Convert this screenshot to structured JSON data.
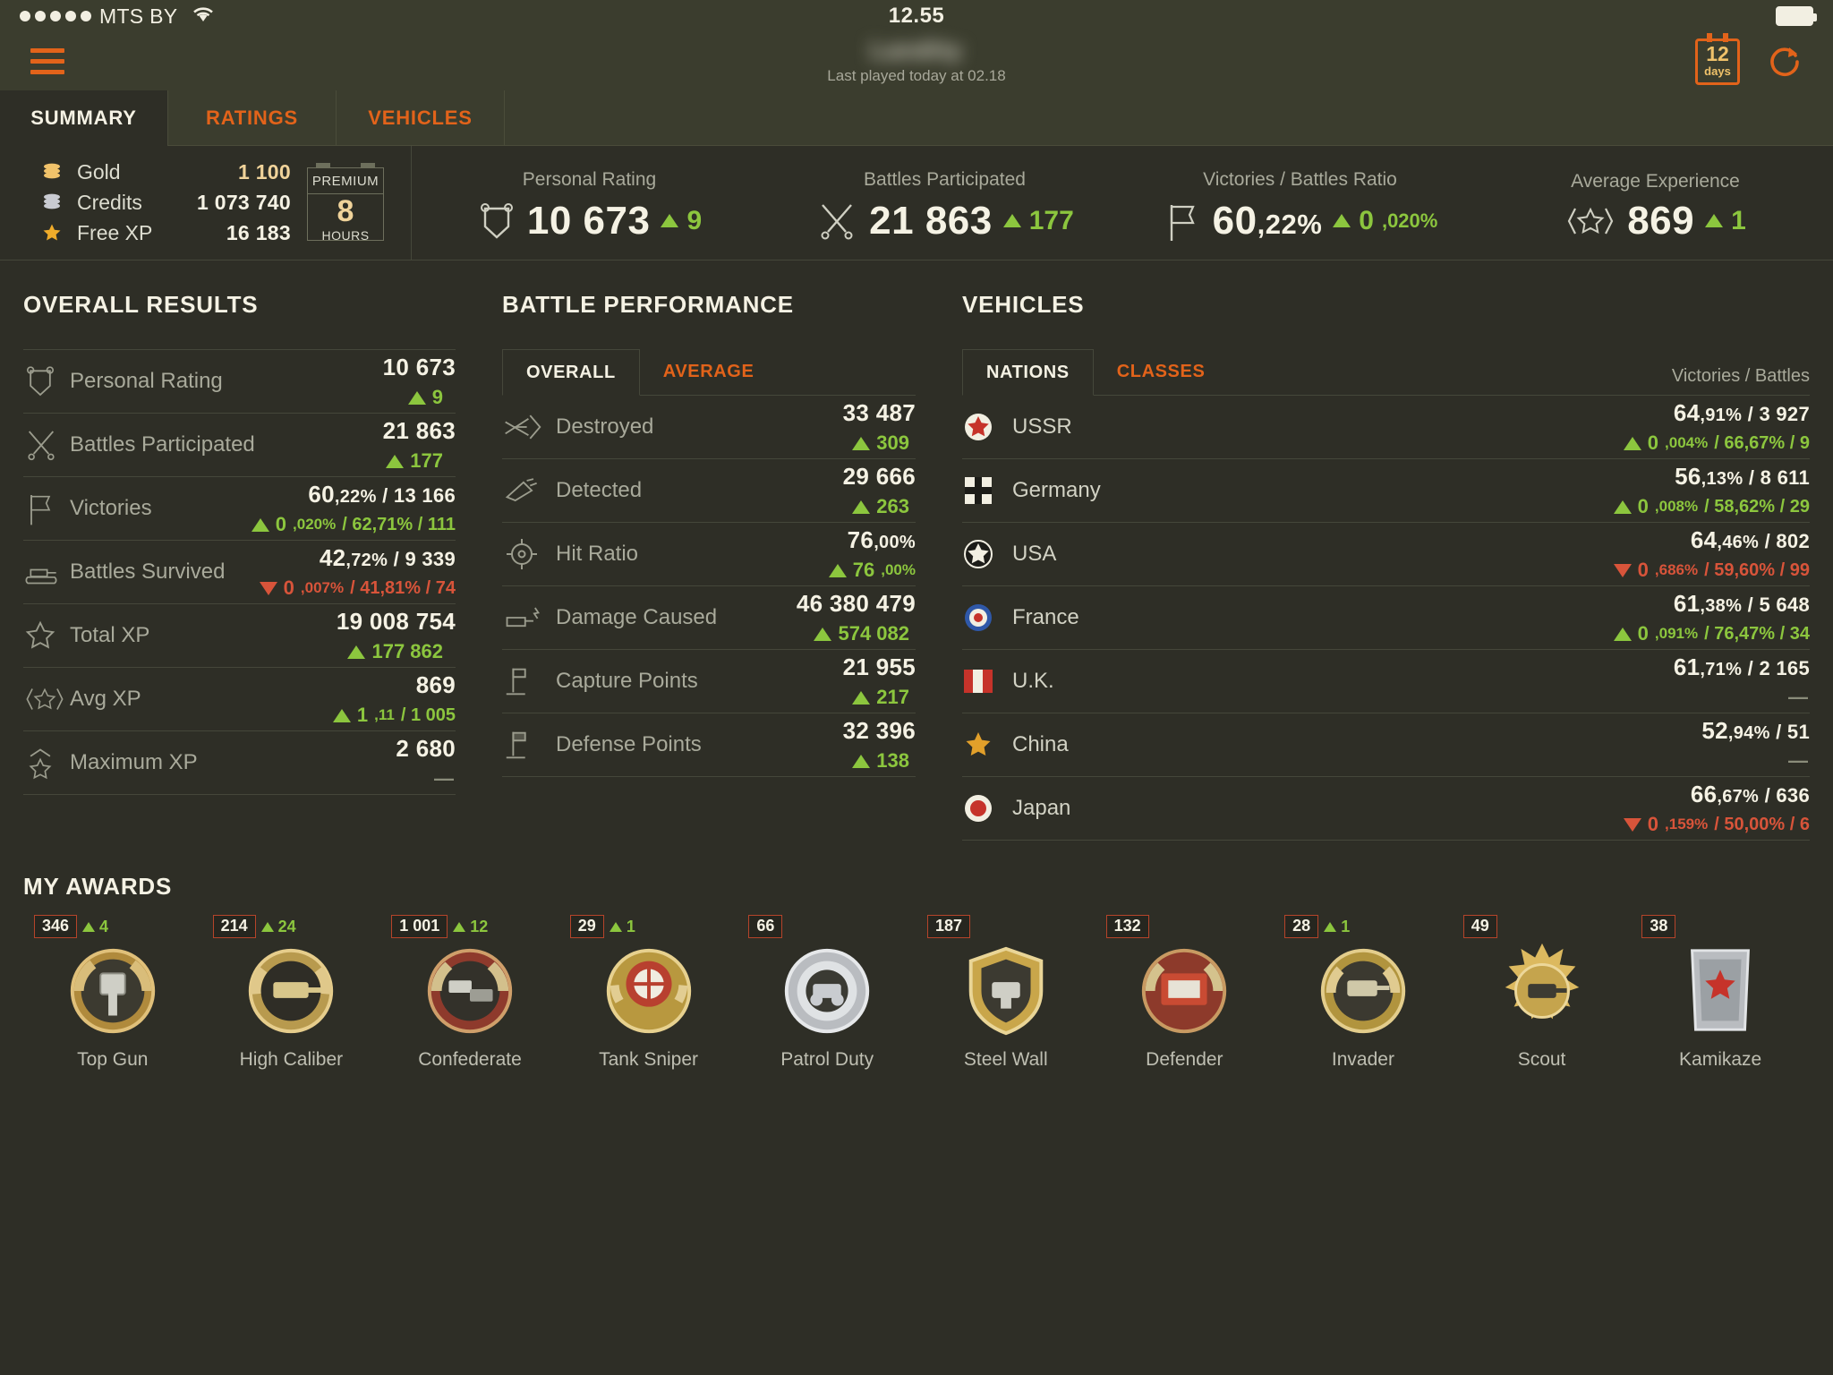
{
  "status_bar": {
    "carrier": "MTS BY",
    "signal_dots": 5,
    "time": "12.55",
    "wifi_icon": "wifi-icon",
    "battery_icon": "battery-full-icon"
  },
  "app_bar": {
    "menu_icon": "hamburger-menu-icon",
    "username": "Landity",
    "last_played": "Last played today at 02.18",
    "calendar": {
      "number": "12",
      "label": "days",
      "icon": "calendar-icon"
    },
    "refresh_icon": "refresh-icon"
  },
  "tabs": [
    {
      "label": "SUMMARY",
      "active": true
    },
    {
      "label": "RATINGS",
      "active": false
    },
    {
      "label": "VEHICLES",
      "active": false
    }
  ],
  "currency": {
    "rows": [
      {
        "icon": "gold-coins-icon",
        "name": "Gold",
        "value": "1 100"
      },
      {
        "icon": "silver-credits-icon",
        "name": "Credits",
        "value": "1 073 740"
      },
      {
        "icon": "star-icon",
        "name": "Free XP",
        "value": "16 183"
      }
    ],
    "premium": {
      "title": "PREMIUM",
      "number": "8",
      "unit": "HOURS"
    }
  },
  "kpis": [
    {
      "label": "Personal Rating",
      "icon": "pennant-icon",
      "value": "10 673",
      "delta": "9",
      "dir": "up"
    },
    {
      "label": "Battles Participated",
      "icon": "crossed-swords-icon",
      "value": "21 863",
      "delta": "177",
      "dir": "up"
    },
    {
      "label": "Victories / Battles Ratio",
      "icon": "flag-icon",
      "value_int": "60",
      "value_dec": ",22%",
      "delta_int": "0",
      "delta_dec": ",020%",
      "dir": "up"
    },
    {
      "label": "Average Experience",
      "icon": "star-brackets-icon",
      "value": "869",
      "delta": "1",
      "dir": "up"
    }
  ],
  "overall_results": {
    "title": "OVERALL RESULTS",
    "rows": [
      {
        "icon": "pennant-icon",
        "name": "Personal Rating",
        "main": "10 673",
        "main_dec": "",
        "extra": "",
        "sub_dir": "up",
        "sub": "9",
        "sub_dec": "",
        "sub_rest": ""
      },
      {
        "icon": "crossed-swords-icon",
        "name": "Battles Participated",
        "main": "21 863",
        "main_dec": "",
        "extra": "",
        "sub_dir": "up",
        "sub": "177",
        "sub_dec": "",
        "sub_rest": ""
      },
      {
        "icon": "flag-icon",
        "name": "Victories",
        "main": "60",
        "main_dec": ",22%",
        "extra": " / 13 166",
        "sub_dir": "up",
        "sub": "0",
        "sub_dec": ",020%",
        "sub_rest": " / 62,71% / 111"
      },
      {
        "icon": "tank-icon",
        "name": "Battles Survived",
        "main": "42",
        "main_dec": ",72%",
        "extra": " / 9 339",
        "sub_dir": "down",
        "sub": "0",
        "sub_dec": ",007%",
        "sub_rest": " / 41,81% / 74"
      },
      {
        "icon": "star-outline-icon",
        "name": "Total XP",
        "main": "19 008 754",
        "main_dec": "",
        "extra": "",
        "sub_dir": "up",
        "sub": "177 862",
        "sub_dec": "",
        "sub_rest": ""
      },
      {
        "icon": "star-brackets-icon",
        "name": "Avg XP",
        "main": "869",
        "main_dec": "",
        "extra": "",
        "sub_dir": "up",
        "sub": "1",
        "sub_dec": ",11",
        "sub_rest": " / 1 005"
      },
      {
        "icon": "star-chevron-icon",
        "name": "Maximum XP",
        "main": "2 680",
        "main_dec": "",
        "extra": "",
        "sub_dir": "none",
        "sub": "—",
        "sub_dec": "",
        "sub_rest": ""
      }
    ]
  },
  "battle_performance": {
    "title": "BATTLE PERFORMANCE",
    "tabs": [
      {
        "label": "OVERALL",
        "active": true
      },
      {
        "label": "AVERAGE",
        "active": false
      }
    ],
    "rows": [
      {
        "icon": "destroyed-icon",
        "name": "Destroyed",
        "main": "33 487",
        "main_dec": "",
        "sub_dir": "up",
        "sub": "309",
        "sub_dec": ""
      },
      {
        "icon": "detected-icon",
        "name": "Detected",
        "main": "29 666",
        "main_dec": "",
        "sub_dir": "up",
        "sub": "263",
        "sub_dec": ""
      },
      {
        "icon": "crosshair-icon",
        "name": "Hit Ratio",
        "main": "76",
        "main_dec": ",00%",
        "sub_dir": "up",
        "sub": "76",
        "sub_dec": ",00%"
      },
      {
        "icon": "damage-icon",
        "name": "Damage Caused",
        "main": "46 380 479",
        "main_dec": "",
        "sub_dir": "up",
        "sub": "574 082",
        "sub_dec": ""
      },
      {
        "icon": "capture-flag-icon",
        "name": "Capture Points",
        "main": "21 955",
        "main_dec": "",
        "sub_dir": "up",
        "sub": "217",
        "sub_dec": ""
      },
      {
        "icon": "defense-flag-icon",
        "name": "Defense Points",
        "main": "32 396",
        "main_dec": "",
        "sub_dir": "up",
        "sub": "138",
        "sub_dec": ""
      }
    ]
  },
  "vehicles": {
    "title": "VEHICLES",
    "tabs": [
      {
        "label": "NATIONS",
        "active": true
      },
      {
        "label": "CLASSES",
        "active": false
      }
    ],
    "header_right": "Victories / Battles",
    "rows": [
      {
        "icon": "ussr-star-icon",
        "name": "USSR",
        "main": "64",
        "main_dec": ",91%",
        "extra": " / 3 927",
        "sub_dir": "up",
        "sub": "0",
        "sub_dec": ",004%",
        "sub_rest": " / 66,67% / 9"
      },
      {
        "icon": "germany-cross-icon",
        "name": "Germany",
        "main": "56",
        "main_dec": ",13%",
        "extra": " / 8 611",
        "sub_dir": "up",
        "sub": "0",
        "sub_dec": ",008%",
        "sub_rest": " / 58,62% / 29"
      },
      {
        "icon": "usa-star-icon",
        "name": "USA",
        "main": "64",
        "main_dec": ",46%",
        "extra": " / 802",
        "sub_dir": "down",
        "sub": "0",
        "sub_dec": ",686%",
        "sub_rest": " / 59,60% / 99"
      },
      {
        "icon": "france-roundel-icon",
        "name": "France",
        "main": "61",
        "main_dec": ",38%",
        "extra": " / 5 648",
        "sub_dir": "up",
        "sub": "0",
        "sub_dec": ",091%",
        "sub_rest": " / 76,47% / 34"
      },
      {
        "icon": "uk-flag-icon",
        "name": "U.K.",
        "main": "61",
        "main_dec": ",71%",
        "extra": " / 2 165",
        "sub_dir": "none",
        "sub": "—",
        "sub_dec": "",
        "sub_rest": ""
      },
      {
        "icon": "china-star-icon",
        "name": "China",
        "main": "52",
        "main_dec": ",94%",
        "extra": " / 51",
        "sub_dir": "none",
        "sub": "—",
        "sub_dec": "",
        "sub_rest": ""
      },
      {
        "icon": "japan-sun-icon",
        "name": "Japan",
        "main": "66",
        "main_dec": ",67%",
        "extra": " / 636",
        "sub_dir": "down",
        "sub": "0",
        "sub_dec": ",159%",
        "sub_rest": " / 50,00% / 6"
      }
    ]
  },
  "awards": {
    "title": "MY AWARDS",
    "items": [
      {
        "name": "Top Gun",
        "count": "346",
        "increase": "4",
        "medal": "top-gun-medal"
      },
      {
        "name": "High Caliber",
        "count": "214",
        "increase": "24",
        "medal": "high-caliber-medal"
      },
      {
        "name": "Confederate",
        "count": "1 001",
        "increase": "12",
        "medal": "confederate-medal"
      },
      {
        "name": "Tank Sniper",
        "count": "29",
        "increase": "1",
        "medal": "tank-sniper-medal"
      },
      {
        "name": "Patrol Duty",
        "count": "66",
        "increase": "",
        "medal": "patrol-duty-medal"
      },
      {
        "name": "Steel Wall",
        "count": "187",
        "increase": "",
        "medal": "steel-wall-medal"
      },
      {
        "name": "Defender",
        "count": "132",
        "increase": "",
        "medal": "defender-medal"
      },
      {
        "name": "Invader",
        "count": "28",
        "increase": "1",
        "medal": "invader-medal"
      },
      {
        "name": "Scout",
        "count": "49",
        "increase": "",
        "medal": "scout-medal"
      },
      {
        "name": "Kamikaze",
        "count": "38",
        "increase": "",
        "medal": "kamikaze-medal"
      }
    ]
  },
  "colors": {
    "background": "#2e2e26",
    "header": "#3b3d2e",
    "accent_orange": "#e2631a",
    "positive_green": "#8cc63e",
    "negative_red": "#d8543a",
    "gold": "#f0d39a",
    "text_primary": "#f5f2e4",
    "text_muted": "#a9aa9b"
  }
}
